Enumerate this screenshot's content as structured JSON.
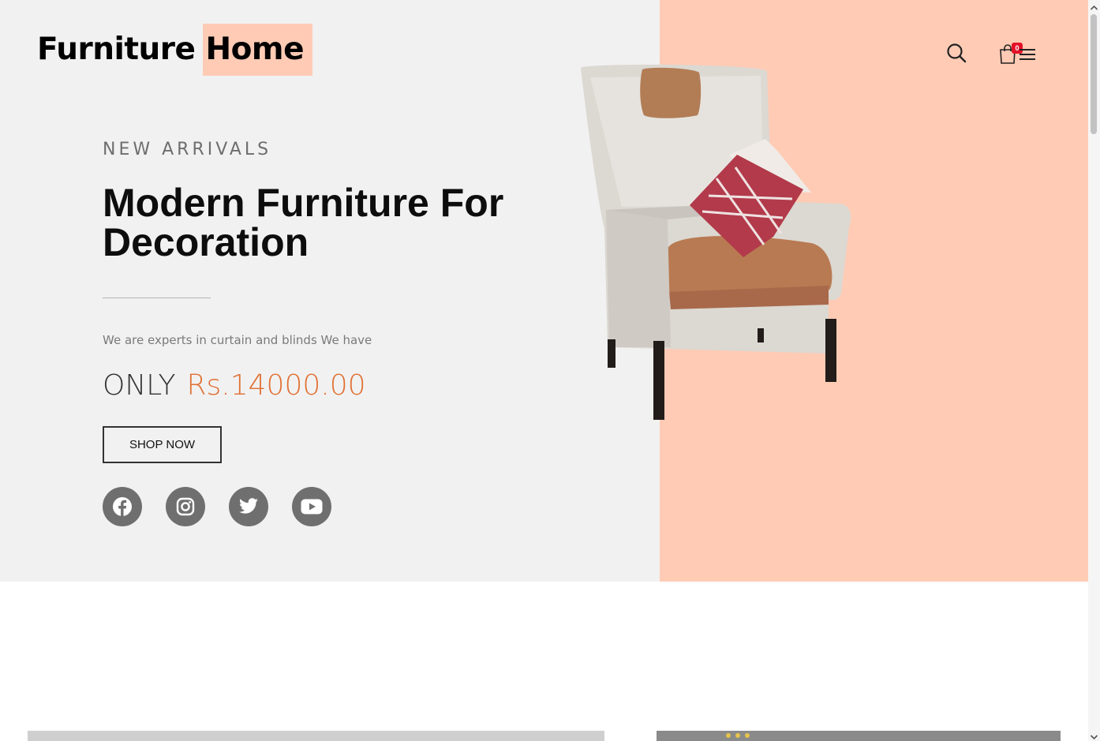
{
  "header": {
    "logo": "Furniture Home",
    "cart_count": "0",
    "icons": [
      "search-icon",
      "shopping-bag-icon",
      "hamburger-menu-icon"
    ]
  },
  "hero": {
    "eyebrow": "NEW ARRIVALS",
    "headline": "Modern Furniture For Decoration",
    "description": "We are experts in curtain and blinds We have",
    "price_label": "ONLY",
    "price_value": "Rs.14000.00",
    "cta_label": "SHOP NOW",
    "social": [
      "facebook-icon",
      "instagram-icon",
      "twitter-icon",
      "youtube-icon"
    ],
    "image": "armchair-with-pillows"
  },
  "colors": {
    "accent_peach": "#ffcbb5",
    "price_orange": "#e07033",
    "hero_background": "#f1f1f1",
    "badge_red": "#e5122a",
    "social_gray": "#6f6f6f"
  }
}
